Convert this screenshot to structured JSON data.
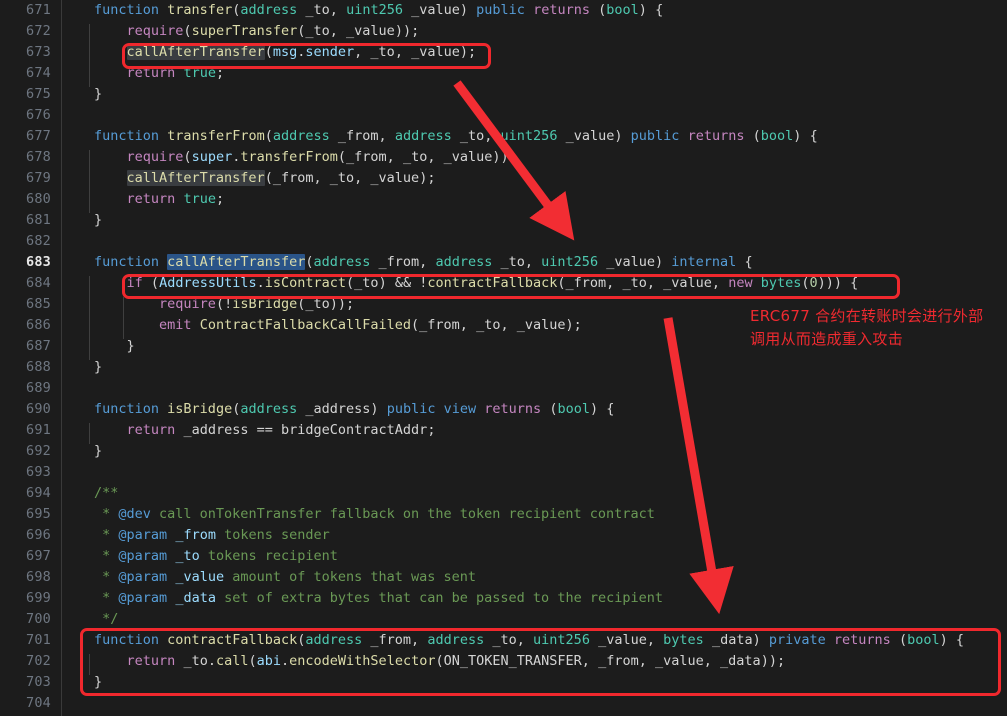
{
  "editor": {
    "theme_bg": "#1c1c1c",
    "gutter_border": "#3a3a3a",
    "active_line_number": "683",
    "annotation_color": "#ef2a30",
    "selection_color": "#2a5488",
    "occurrence_color": "#3a3d41"
  },
  "line_numbers": [
    "671",
    "672",
    "673",
    "674",
    "675",
    "676",
    "677",
    "678",
    "679",
    "680",
    "681",
    "682",
    "683",
    "684",
    "685",
    "686",
    "687",
    "688",
    "689",
    "690",
    "691",
    "692",
    "693",
    "694",
    "695",
    "696",
    "697",
    "698",
    "699",
    "700",
    "701",
    "702",
    "703",
    "704"
  ],
  "code_lines": [
    {
      "n": "671",
      "text": "function transfer(address _to, uint256 _value) public returns (bool) {"
    },
    {
      "n": "672",
      "text": "    require(superTransfer(_to, _value));"
    },
    {
      "n": "673",
      "text": "    callAfterTransfer(msg.sender, _to, _value);"
    },
    {
      "n": "674",
      "text": "    return true;"
    },
    {
      "n": "675",
      "text": "}"
    },
    {
      "n": "676",
      "text": ""
    },
    {
      "n": "677",
      "text": "function transferFrom(address _from, address _to, uint256 _value) public returns (bool) {"
    },
    {
      "n": "678",
      "text": "    require(super.transferFrom(_from, _to, _value));"
    },
    {
      "n": "679",
      "text": "    callAfterTransfer(_from, _to, _value);"
    },
    {
      "n": "680",
      "text": "    return true;"
    },
    {
      "n": "681",
      "text": "}"
    },
    {
      "n": "682",
      "text": ""
    },
    {
      "n": "683",
      "text": "function callAfterTransfer(address _from, address _to, uint256 _value) internal {"
    },
    {
      "n": "684",
      "text": "    if (AddressUtils.isContract(_to) && !contractFallback(_from, _to, _value, new bytes(0))) {"
    },
    {
      "n": "685",
      "text": "        require(!isBridge(_to));"
    },
    {
      "n": "686",
      "text": "        emit ContractFallbackCallFailed(_from, _to, _value);"
    },
    {
      "n": "687",
      "text": "    }"
    },
    {
      "n": "688",
      "text": "}"
    },
    {
      "n": "689",
      "text": ""
    },
    {
      "n": "690",
      "text": "function isBridge(address _address) public view returns (bool) {"
    },
    {
      "n": "691",
      "text": "    return _address == bridgeContractAddr;"
    },
    {
      "n": "692",
      "text": "}"
    },
    {
      "n": "693",
      "text": ""
    },
    {
      "n": "694",
      "text": "/**"
    },
    {
      "n": "695",
      "text": " * @dev call onTokenTransfer fallback on the token recipient contract"
    },
    {
      "n": "696",
      "text": " * @param _from tokens sender"
    },
    {
      "n": "697",
      "text": " * @param _to tokens recipient"
    },
    {
      "n": "698",
      "text": " * @param _value amount of tokens that was sent"
    },
    {
      "n": "699",
      "text": " * @param _data set of extra bytes that can be passed to the recipient"
    },
    {
      "n": "700",
      "text": " */"
    },
    {
      "n": "701",
      "text": "function contractFallback(address _from, address _to, uint256 _value, bytes _data) private returns (bool) {"
    },
    {
      "n": "702",
      "text": "    return _to.call(abi.encodeWithSelector(ON_TOKEN_TRANSFER, _from, _value, _data));"
    },
    {
      "n": "703",
      "text": "}"
    },
    {
      "n": "704",
      "text": ""
    }
  ],
  "annotations": {
    "note_1": "ERC677 合约在转账时会进行外部\n调用从而造成重入攻击",
    "highlight_boxes": [
      {
        "name": "box-call-after-transfer-line-673",
        "label": "callAfterTransfer(msg.sender, _to, _value);"
      },
      {
        "name": "box-if-contract-fallback-line-684",
        "label": "if (AddressUtils.isContract(_to) && !contractFallback(_from, _to, _value, new bytes(0))) {"
      },
      {
        "name": "box-contract-fallback-function-701-703",
        "label": "function contractFallback(...) private returns (bool) { ... }"
      }
    ],
    "arrows": [
      {
        "name": "arrow-transfer-to-call-after-transfer",
        "from": "line 673 highlight",
        "to": "line 683 callAfterTransfer definition"
      },
      {
        "name": "arrow-if-to-contract-fallback",
        "from": "line 684 highlight",
        "to": "line 701 contractFallback definition"
      }
    ]
  }
}
